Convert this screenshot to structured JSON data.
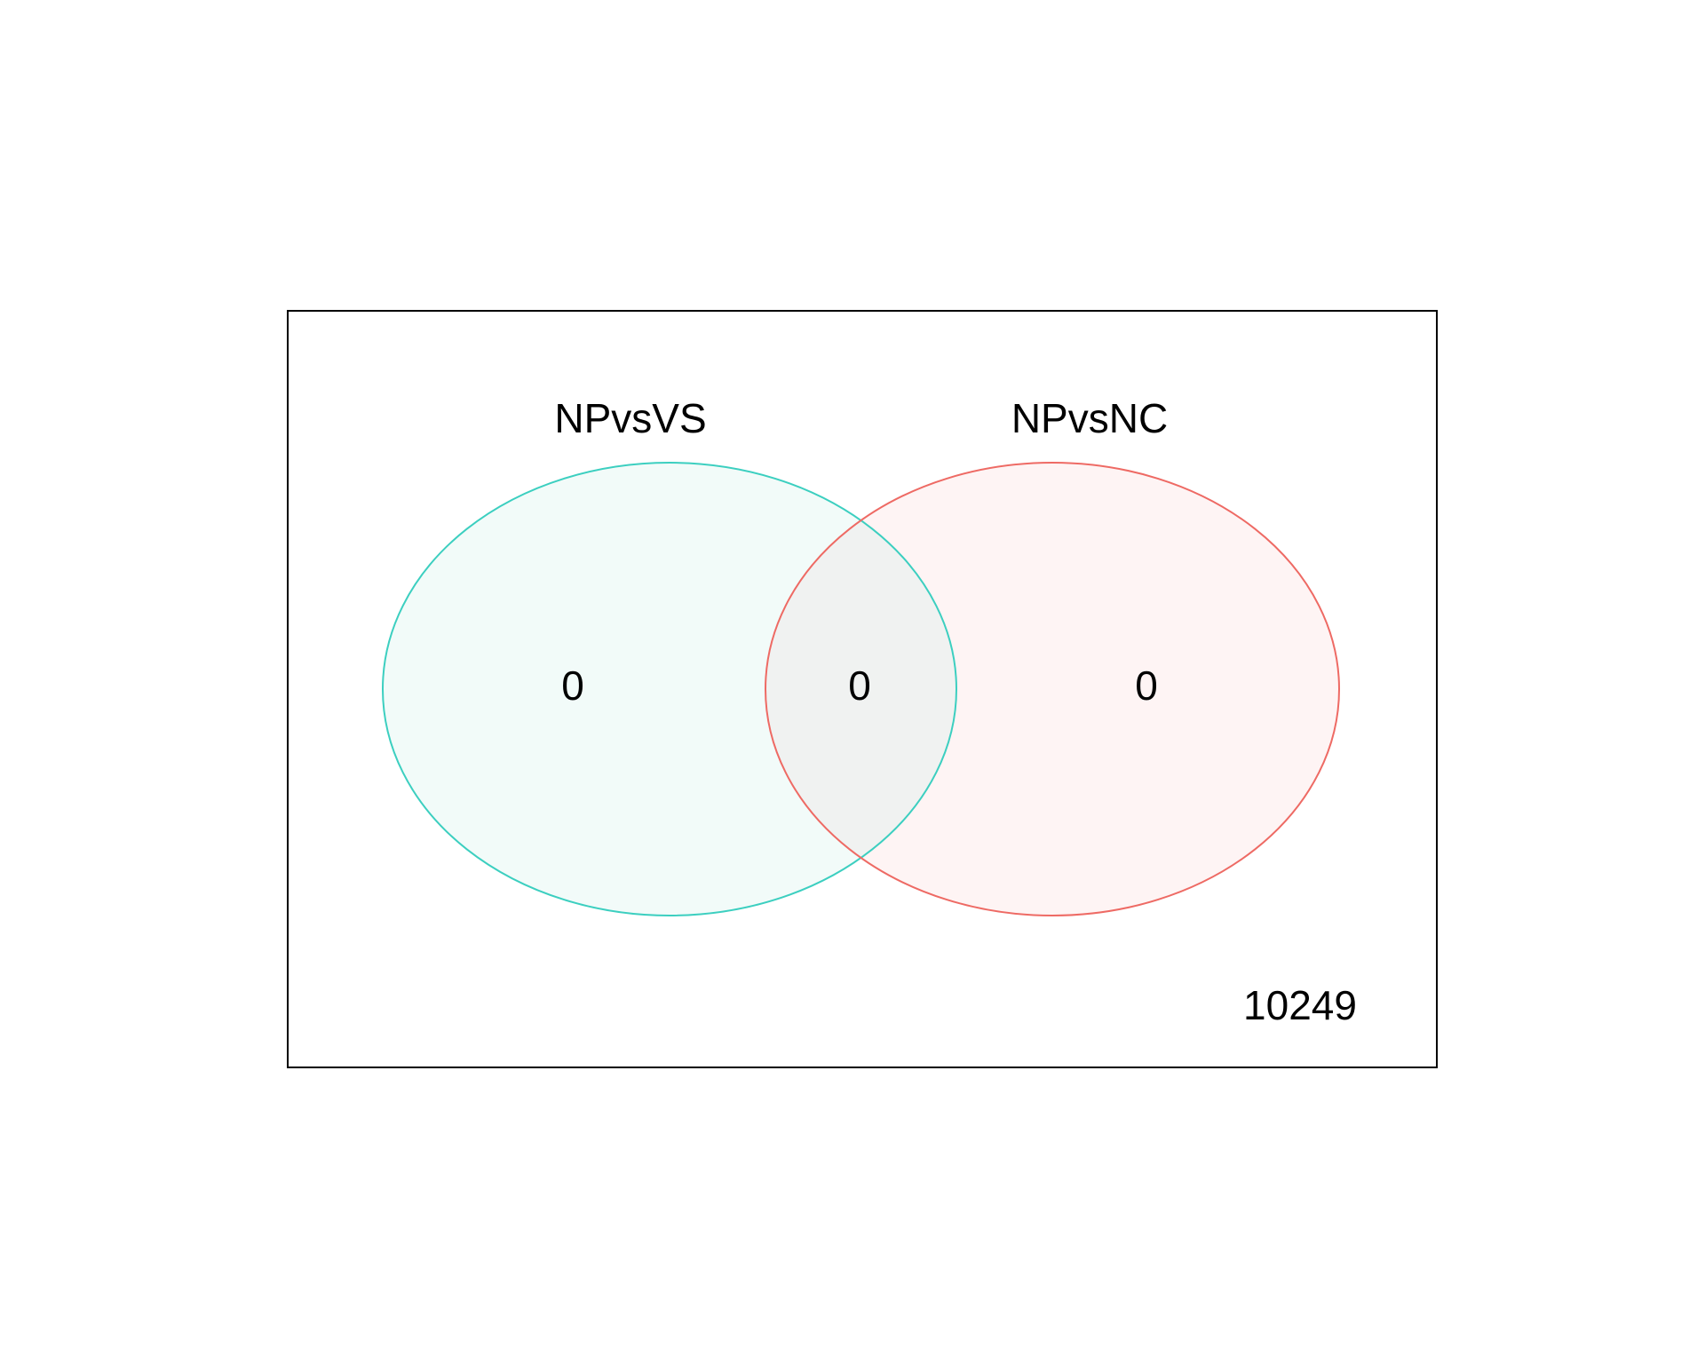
{
  "diagram": {
    "type": "venn",
    "sets": [
      {
        "label": "NPvsVS",
        "color": "#3CCFC0",
        "fill": "#F2FBF9"
      },
      {
        "label": "NPvsNC",
        "color": "#EE6A64",
        "fill": "#FEF4F4"
      }
    ],
    "intersection_fill": "#F0F2F1",
    "counts": {
      "only_a": "0",
      "both": "0",
      "only_b": "0",
      "neither": "10249"
    },
    "frame_color": "#000000"
  }
}
